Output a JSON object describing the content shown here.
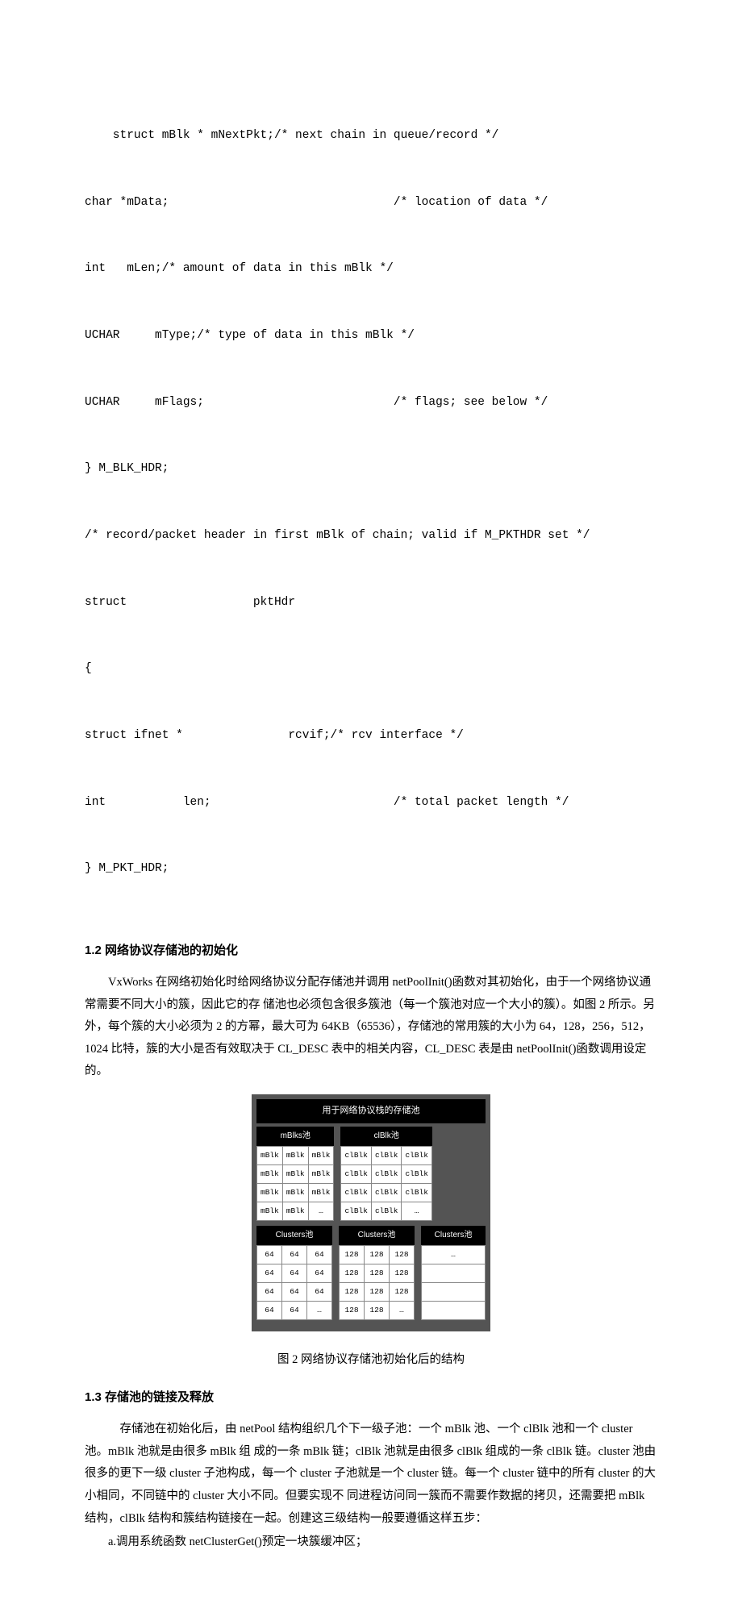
{
  "code": {
    "l1": "    struct mBlk * mNextPkt;/* next chain in queue/record */",
    "l2": "char *mData;                                /* location of data */",
    "l3": "int   mLen;/* amount of data in this mBlk */",
    "l4": "UCHAR     mType;/* type of data in this mBlk */",
    "l5": "UCHAR     mFlags;                           /* flags; see below */",
    "l6": "} M_BLK_HDR;",
    "l7": "/* record/packet header in first mBlk of chain; valid if M_PKTHDR set */",
    "l8": "struct                  pktHdr",
    "l9": "{",
    "l10": "struct ifnet *               rcvif;/* rcv interface */",
    "l11": "int           len;                          /* total packet length */",
    "l12": "} M_PKT_HDR;"
  },
  "headings": {
    "h12": "1.2   网络协议存储池的初始化",
    "h13": "1.3   存储池的链接及释放"
  },
  "section12": {
    "p1": "VxWorks 在网络初始化时给网络协议分配存储池并调用 netPoolInit()函数对其初始化，由于一个网络协议通常需要不同大小的簇，因此它的存 储池也必须包含很多簇池（每一个簇池对应一个大小的簇）。如图 2 所示。另外，每个簇的大小必须为 2 的方幂，最大可为 64KB（65536），存储池的常用簇的大小为 64，128，256，512，1024 比特，簇的大小是否有效取决于 CL_DESC 表中的相关内容，CL_DESC 表是由  netPoolInit()函数调用设定的。"
  },
  "figure": {
    "title": "用于网络协议栈的存储池",
    "pools": {
      "mblks": {
        "head": "mBlks池",
        "cells": [
          [
            "mBlk",
            "mBlk",
            "mBlk"
          ],
          [
            "mBlk",
            "mBlk",
            "mBlk"
          ],
          [
            "mBlk",
            "mBlk",
            "mBlk"
          ],
          [
            "mBlk",
            "mBlk",
            "…"
          ]
        ]
      },
      "clblk": {
        "head": "clBlk池",
        "cells": [
          [
            "clBlk",
            "clBlk",
            "clBlk"
          ],
          [
            "clBlk",
            "clBlk",
            "clBlk"
          ],
          [
            "clBlk",
            "clBlk",
            "clBlk"
          ],
          [
            "clBlk",
            "clBlk",
            "…"
          ]
        ]
      },
      "c1": {
        "head": "Clusters池",
        "cells": [
          [
            "64",
            "64",
            "64"
          ],
          [
            "64",
            "64",
            "64"
          ],
          [
            "64",
            "64",
            "64"
          ],
          [
            "64",
            "64",
            "…"
          ]
        ]
      },
      "c2": {
        "head": "Clusters池",
        "cells": [
          [
            "128",
            "128",
            "128"
          ],
          [
            "128",
            "128",
            "128"
          ],
          [
            "128",
            "128",
            "128"
          ],
          [
            "128",
            "128",
            "…"
          ]
        ]
      },
      "c3": {
        "head": "Clusters池",
        "cells": [
          [
            "…"
          ]
        ],
        "blanks": 3
      }
    },
    "caption": "图 2     网络协议存储池初始化后的结构"
  },
  "section13": {
    "p1": "存储池在初始化后，由 netPool 结构组织几个下一级子池：一个 mBlk 池、一个 clBlk 池和一个 cluster 池。mBlk 池就是由很多 mBlk 组 成的一条 mBlk 链；clBlk 池就是由很多 clBlk 组成的一条 clBlk 链。cluster 池由很多的更下一级 cluster 子池构成，每一个 cluster 子池就是一个 cluster 链。每一个 cluster 链中的所有 cluster 的大小相同，不同链中的 cluster 大小不同。但要实现不 同进程访问同一簇而不需要作数据的拷贝，还需要把 mBlk 结构，clBlk 结构和簇结构链接在一起。创建这三级结构一般要遵循这样五步：",
    "a": "a.调用系统函数 netClusterGet()预定一块簇缓冲区；"
  }
}
